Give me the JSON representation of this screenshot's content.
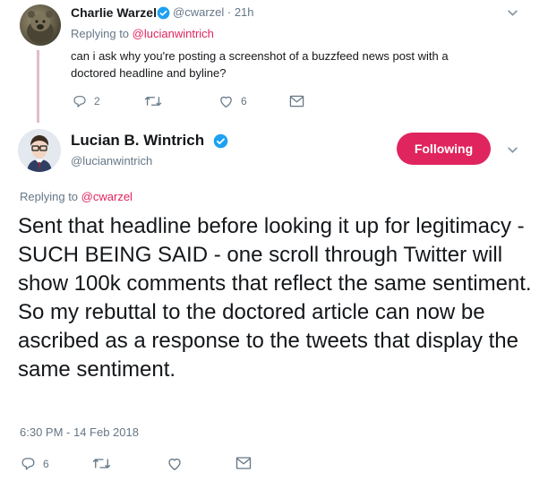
{
  "parent_tweet": {
    "author_name": "Charlie Warzel",
    "handle_time": "@cwarzel · 21h",
    "replying_label": "Replying to",
    "replying_to": "@lucianwintrich",
    "text": "can i ask why you're posting a screenshot of a buzzfeed news post with a doctored headline and byline?",
    "reply_count": "2",
    "retweet_count": "",
    "like_count": "6"
  },
  "main_tweet": {
    "author_name": "Lucian B. Wintrich",
    "handle": "@lucianwintrich",
    "follow_label": "Following",
    "replying_label": "Replying to",
    "replying_to": "@cwarzel",
    "text": "Sent that headline before looking it up for legitimacy - SUCH BEING SAID - one scroll through Twitter will show 100k comments that reflect the same sentiment. So my rebuttal to the doctored article can now be ascribed as a response to the tweets that display the same sentiment.",
    "timestamp": "6:30 PM - 14 Feb 2018",
    "reply_count": "6",
    "retweet_count": "",
    "like_count": ""
  },
  "colors": {
    "accent": "#e0245e",
    "verified": "#1da1f2",
    "muted": "#657786",
    "thread_line": "#e1bcc8"
  },
  "icons": [
    "reply-icon",
    "retweet-icon",
    "like-icon",
    "dm-icon",
    "verified-badge-icon",
    "chevron-down-icon"
  ]
}
